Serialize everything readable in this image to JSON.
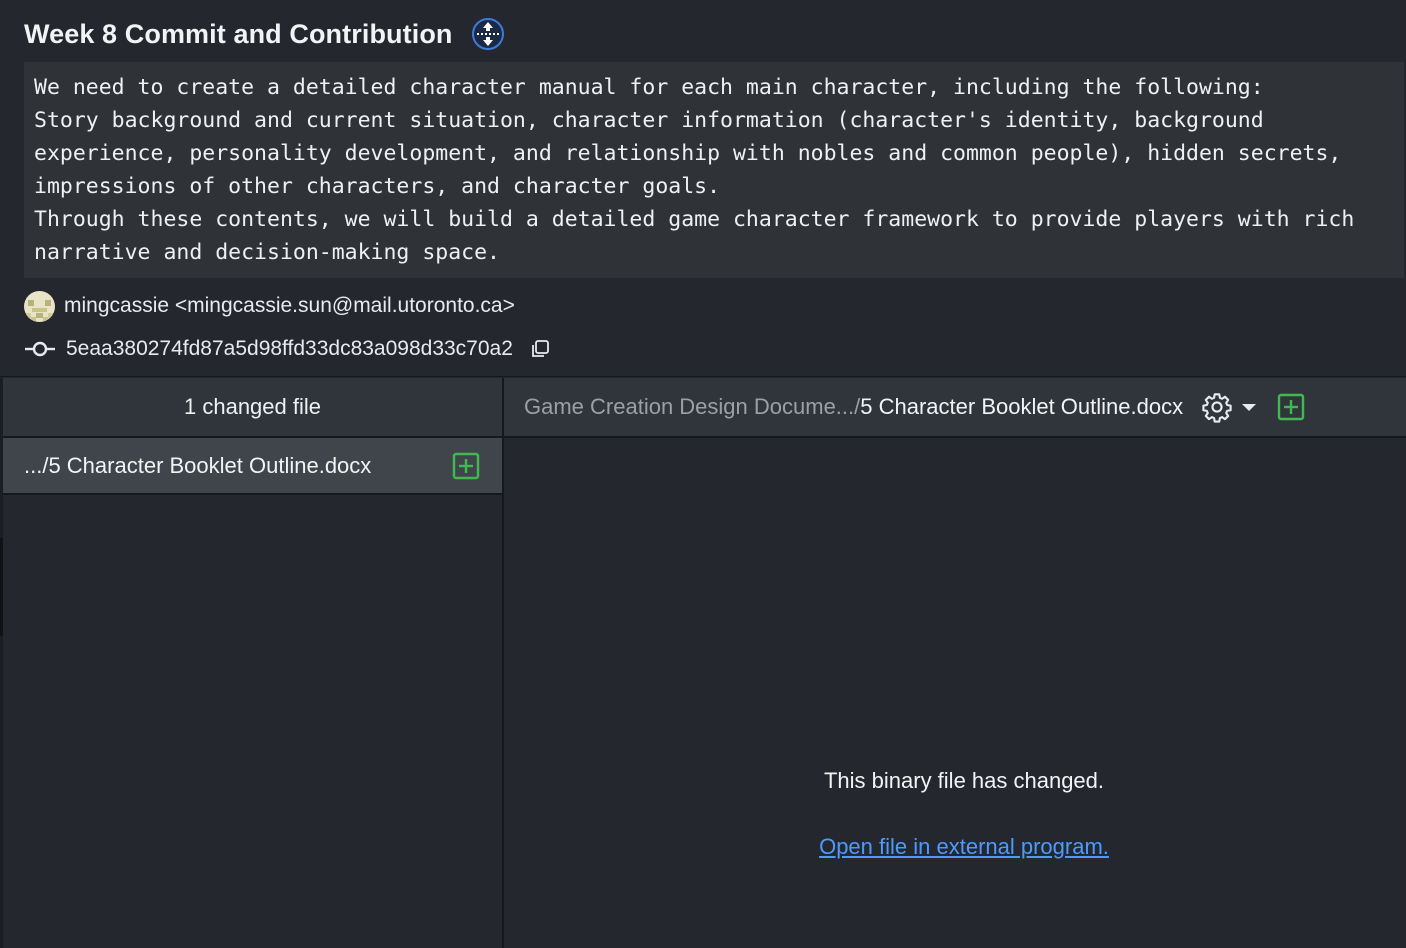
{
  "commit": {
    "title": "Week 8 Commit and Contribution",
    "message": "We need to create a detailed character manual for each main character, including the following:\nStory background and current situation, character information (character's identity, background experience, personality development, and relationship with nobles and common people), hidden secrets, impressions of other characters, and character goals.\nThrough these contents, we will build a detailed game character framework to provide players with rich narrative and decision-making space.",
    "author": "mingcassie <mingcassie.sun@mail.utoronto.ca>",
    "hash": "5eaa380274fd87a5d98ffd33dc83a098d33c70a2"
  },
  "files_panel": {
    "header": "1 changed file",
    "files": [
      {
        "name": ".../5 Character Booklet Outline.docx",
        "status_icon": "added-icon"
      }
    ]
  },
  "diff_panel": {
    "path_prefix": "Game Creation Design Docume.../",
    "file_name": "5 Character Booklet Outline.docx",
    "binary_message": "This binary file has changed.",
    "open_link": "Open file in external program."
  },
  "icons": {
    "expand": "expand-icon",
    "commit": "commit-icon",
    "copy": "copy-icon",
    "settings": "gear-icon",
    "dropdown": "chevron-down-icon",
    "added": "added-icon"
  },
  "colors": {
    "background": "#24282e",
    "panel_header": "#30353b",
    "selected_row": "#40454b",
    "added_green": "#3fb950",
    "link_blue": "#4d9aff"
  }
}
